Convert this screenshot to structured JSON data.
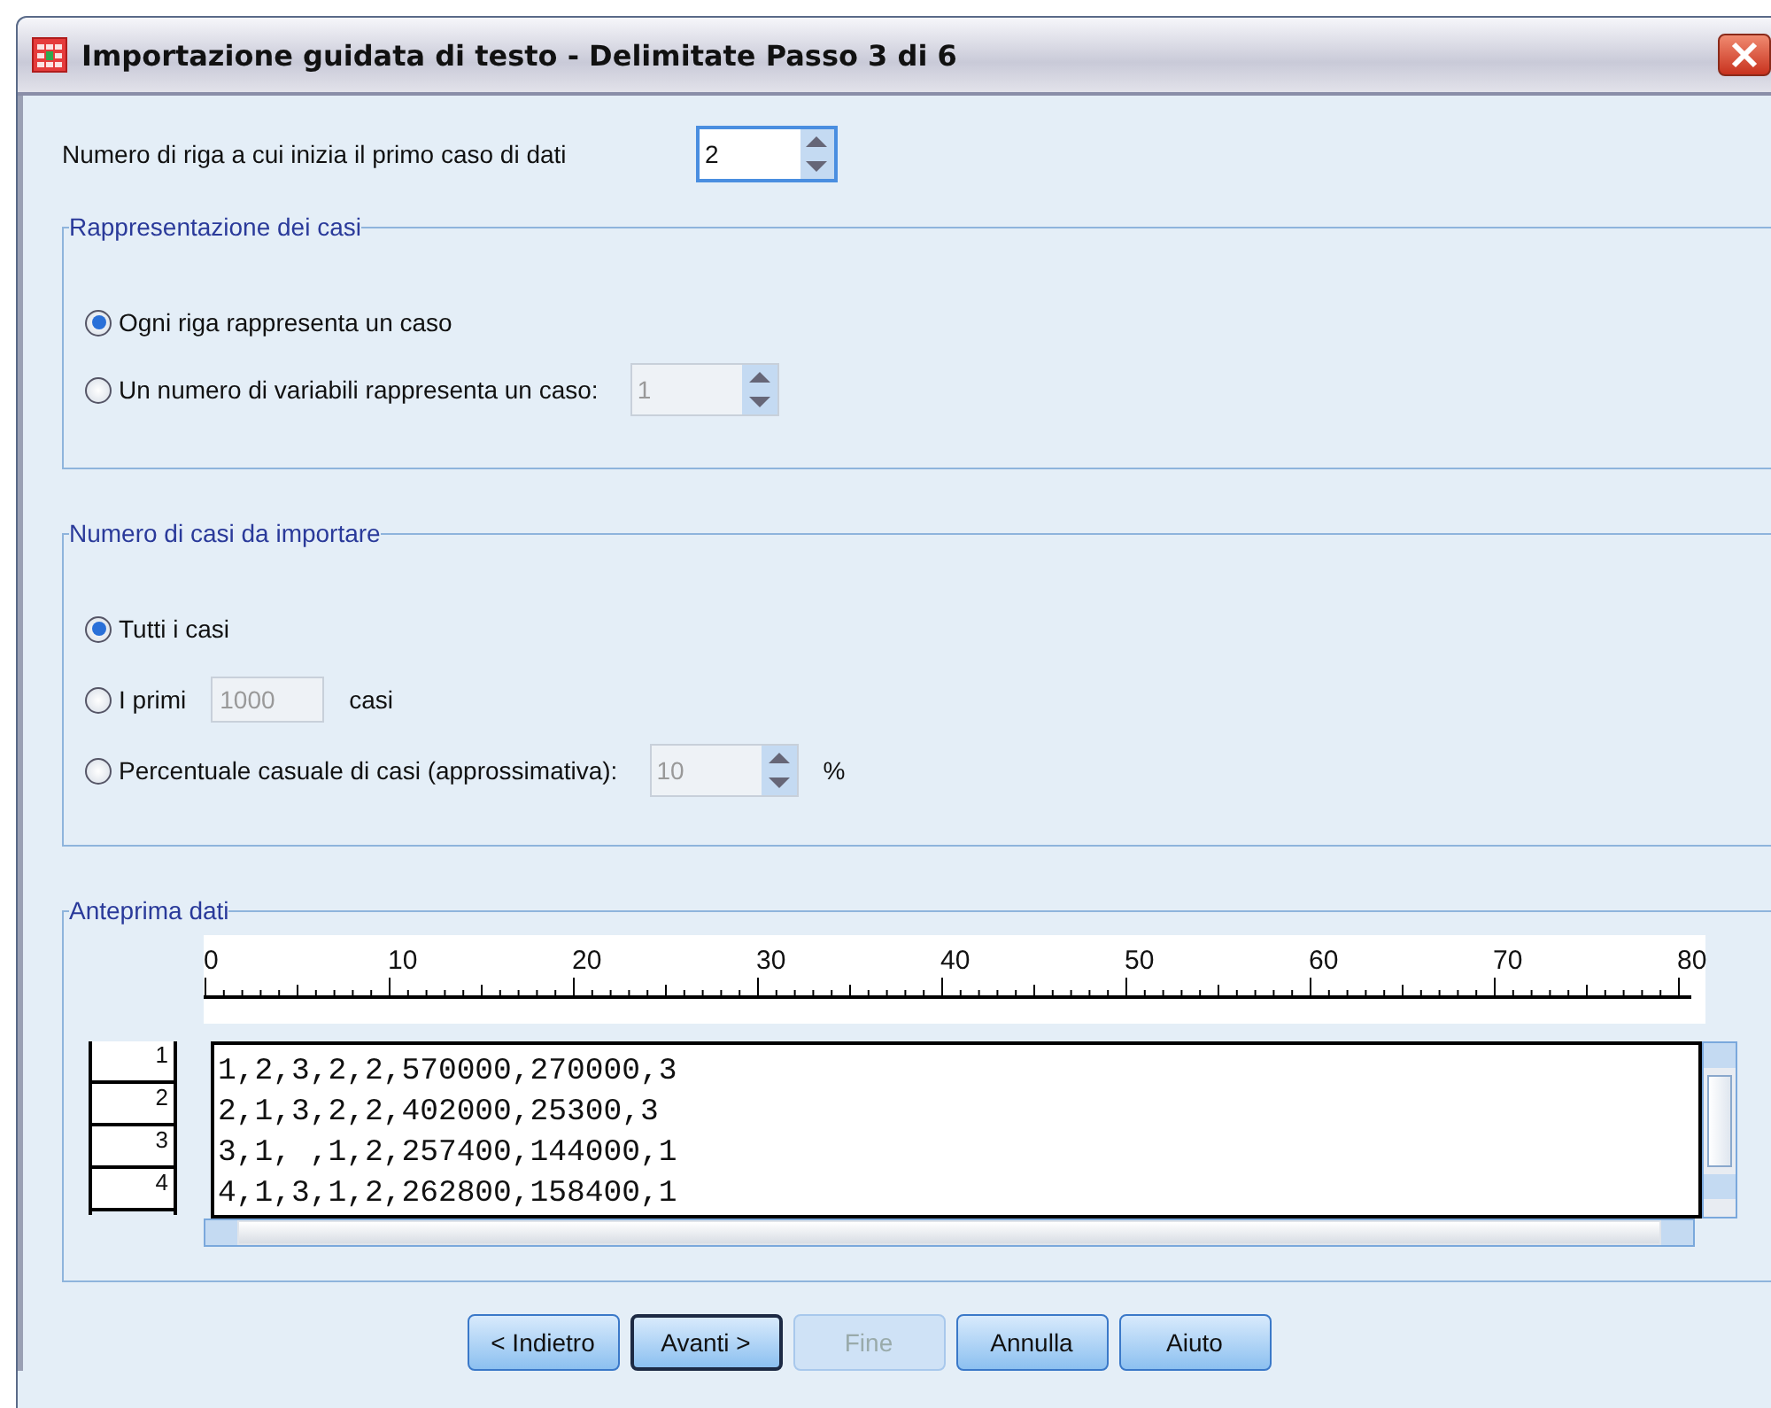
{
  "window": {
    "title": "Importazione guidata di testo - Delimitate Passo 3 di 6"
  },
  "start_row": {
    "label": "Numero di riga a cui inizia il primo caso di dati",
    "value": "2"
  },
  "groups": [
    {
      "title": "Rappresentazione dei casi",
      "options": [
        {
          "kind": "plain",
          "label": "Ogni riga rappresenta un caso",
          "selected": true
        },
        {
          "kind": "spin",
          "label": "Un numero di variabili rappresenta un caso:",
          "value": "1",
          "disabled": true,
          "selected": false
        }
      ]
    },
    {
      "title": "Numero di casi da importare",
      "options": [
        {
          "kind": "plain",
          "label": "Tutti i casi",
          "selected": true
        },
        {
          "kind": "field",
          "label": "I primi",
          "value": "1000",
          "suffix": "casi",
          "disabled": true,
          "selected": false
        },
        {
          "kind": "spin",
          "label": "Percentuale casuale di casi (approssimativa):",
          "value": "10",
          "suffix": "%",
          "disabled": true,
          "selected": false
        }
      ]
    }
  ],
  "preview": {
    "title": "Anteprima dati",
    "ruler": [
      "0",
      "10",
      "20",
      "30",
      "40",
      "50",
      "60",
      "70",
      "80"
    ],
    "rows": [
      {
        "number": "1",
        "text": "1,2,3,2,2,570000,270000,3"
      },
      {
        "number": "2",
        "text": "2,1,3,2,2,402000,25300,3"
      },
      {
        "number": "3",
        "text": "3,1, ,1,2,257400,144000,1"
      },
      {
        "number": "4",
        "text": "4,1,3,1,2,262800,158400,1"
      }
    ]
  },
  "buttons": [
    {
      "label": "< Indietro",
      "disabled": false,
      "default": false
    },
    {
      "label": "Avanti >",
      "disabled": false,
      "default": true
    },
    {
      "label": "Fine",
      "disabled": true,
      "default": false
    },
    {
      "label": "Annulla",
      "disabled": false,
      "default": false
    },
    {
      "label": "Aiuto",
      "disabled": false,
      "default": false
    }
  ]
}
